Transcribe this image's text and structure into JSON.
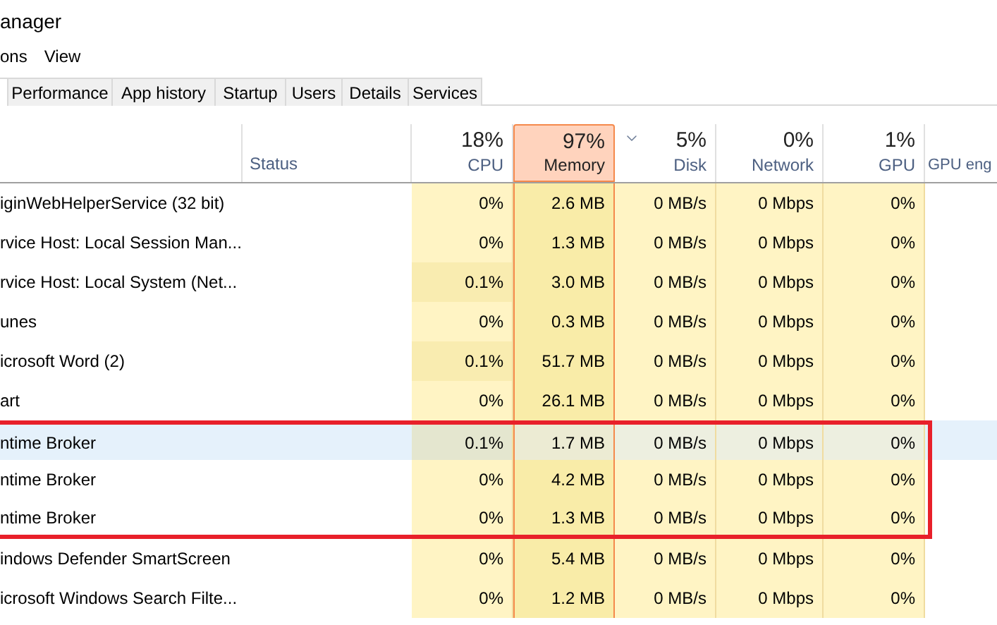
{
  "window": {
    "title": "anager"
  },
  "menu": [
    "ons",
    "View"
  ],
  "tabs": [
    {
      "selected": true
    },
    {
      "label": "Performance",
      "selected": false
    },
    {
      "label": "App history",
      "selected": false
    },
    {
      "label": "Startup",
      "selected": false
    },
    {
      "label": "Users",
      "selected": false
    },
    {
      "label": "Details",
      "selected": false
    },
    {
      "label": "Services",
      "selected": false
    }
  ],
  "columns": [
    {
      "label": "Status",
      "kind": "text"
    },
    {
      "percent": "18%",
      "label": "CPU",
      "kind": "metric",
      "selected": false,
      "sort_arrow": false
    },
    {
      "percent": "97%",
      "label": "Memory",
      "kind": "metric",
      "selected": true,
      "sort_arrow": false
    },
    {
      "percent": "5%",
      "label": "Disk",
      "kind": "metric",
      "selected": false,
      "sort_arrow": true
    },
    {
      "percent": "0%",
      "label": "Network",
      "kind": "metric",
      "selected": false,
      "sort_arrow": false
    },
    {
      "percent": "1%",
      "label": "GPU",
      "kind": "metric",
      "selected": false,
      "sort_arrow": false
    },
    {
      "label": "GPU eng",
      "kind": "text"
    }
  ],
  "rows": [
    {
      "name": "iginWebHelperService (32 bit)",
      "cpu": "0%",
      "cpu_busy": false,
      "memory": "2.6 MB",
      "disk": "0 MB/s",
      "network": "0 Mbps",
      "gpu": "0%",
      "selected": false,
      "boxed": false
    },
    {
      "name": "rvice Host: Local Session Man...",
      "cpu": "0%",
      "cpu_busy": false,
      "memory": "1.3 MB",
      "disk": "0 MB/s",
      "network": "0 Mbps",
      "gpu": "0%",
      "selected": false,
      "boxed": false
    },
    {
      "name": "rvice Host: Local System (Net...",
      "cpu": "0.1%",
      "cpu_busy": true,
      "memory": "3.0 MB",
      "disk": "0 MB/s",
      "network": "0 Mbps",
      "gpu": "0%",
      "selected": false,
      "boxed": false
    },
    {
      "name": "unes",
      "cpu": "0%",
      "cpu_busy": false,
      "memory": "0.3 MB",
      "disk": "0 MB/s",
      "network": "0 Mbps",
      "gpu": "0%",
      "selected": false,
      "boxed": false
    },
    {
      "name": "icrosoft Word (2)",
      "cpu": "0.1%",
      "cpu_busy": true,
      "memory": "51.7 MB",
      "disk": "0 MB/s",
      "network": "0 Mbps",
      "gpu": "0%",
      "selected": false,
      "boxed": false
    },
    {
      "name": "art",
      "cpu": "0%",
      "cpu_busy": false,
      "memory": "26.1 MB",
      "disk": "0 MB/s",
      "network": "0 Mbps",
      "gpu": "0%",
      "selected": false,
      "boxed": false
    },
    {
      "name": "ntime Broker",
      "cpu": "0.1%",
      "cpu_busy": true,
      "memory": "1.7 MB",
      "disk": "0 MB/s",
      "network": "0 Mbps",
      "gpu": "0%",
      "selected": true,
      "boxed": true
    },
    {
      "name": "ntime Broker",
      "cpu": "0%",
      "cpu_busy": false,
      "memory": "4.2 MB",
      "disk": "0 MB/s",
      "network": "0 Mbps",
      "gpu": "0%",
      "selected": false,
      "boxed": true
    },
    {
      "name": "ntime Broker",
      "cpu": "0%",
      "cpu_busy": false,
      "memory": "1.3 MB",
      "disk": "0 MB/s",
      "network": "0 Mbps",
      "gpu": "0%",
      "selected": false,
      "boxed": true
    },
    {
      "name": "indows Defender SmartScreen",
      "cpu": "0%",
      "cpu_busy": false,
      "memory": "5.4 MB",
      "disk": "0 MB/s",
      "network": "0 Mbps",
      "gpu": "0%",
      "selected": false,
      "boxed": false
    },
    {
      "name": "icrosoft Windows Search Filte...",
      "cpu": "0%",
      "cpu_busy": false,
      "memory": "1.2 MB",
      "disk": "0 MB/s",
      "network": "0 Mbps",
      "gpu": "0%",
      "selected": false,
      "boxed": false
    }
  ]
}
